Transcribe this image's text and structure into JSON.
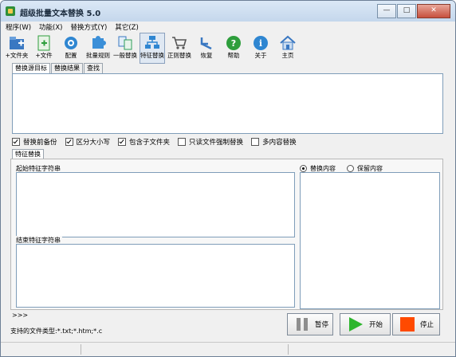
{
  "window": {
    "title": "超级批量文本替换 5.0",
    "min": "—",
    "max": "□",
    "close": "✕"
  },
  "menu": [
    "程序(W)",
    "功能(X)",
    "替换方式(Y)",
    "其它(Z)"
  ],
  "toolbar": [
    {
      "label": "+文件夹",
      "icon": "folder-add-icon",
      "color": "#3a78c2"
    },
    {
      "label": "+文件",
      "icon": "file-add-icon",
      "color": "#2e9e3c"
    },
    {
      "label": "配置",
      "icon": "config-icon",
      "color": "#2f86d1"
    },
    {
      "label": "批量规则",
      "icon": "puzzle-icon",
      "color": "#3b8fd8"
    },
    {
      "label": "一般替换",
      "icon": "general-replace-icon",
      "color": "#2f9e5a"
    },
    {
      "label": "特征替换",
      "icon": "feature-replace-icon",
      "color": "#2f86d1"
    },
    {
      "label": "正则替换",
      "icon": "cart-icon",
      "color": "#555555"
    },
    {
      "label": "恢复",
      "icon": "undo-icon",
      "color": "#3a78c2"
    },
    {
      "label": "帮助",
      "icon": "help-icon",
      "color": "#2e9e3c"
    },
    {
      "label": "关于",
      "icon": "info-icon",
      "color": "#2f86d1"
    },
    {
      "label": "主页",
      "icon": "home-icon",
      "color": "#3a78c2"
    }
  ],
  "top_tabs": [
    "替换源目标",
    "替换结果",
    "查找"
  ],
  "options": [
    {
      "label": "替换前备份",
      "checked": true
    },
    {
      "label": "区分大小写",
      "checked": true
    },
    {
      "label": "包含子文件夹",
      "checked": true
    },
    {
      "label": "只读文件强制替换",
      "checked": false
    },
    {
      "label": "多内容替换",
      "checked": false
    }
  ],
  "mode_tab": "特征替换",
  "start_label": "起始特征字符串",
  "end_label": "结束特征字符串",
  "radios": [
    {
      "label": "替换内容",
      "checked": true
    },
    {
      "label": "保留内容",
      "checked": false
    }
  ],
  "prompt": ">>>",
  "file_types": "支持的文件类型:*.txt;*.htm;*.c",
  "buttons": {
    "pause": "暂停",
    "start": "开始",
    "stop": "停止"
  },
  "colors": {
    "start_icon": "#2db52d",
    "stop_icon": "#ff4a00",
    "pause_icon": "#8e8e8e"
  }
}
